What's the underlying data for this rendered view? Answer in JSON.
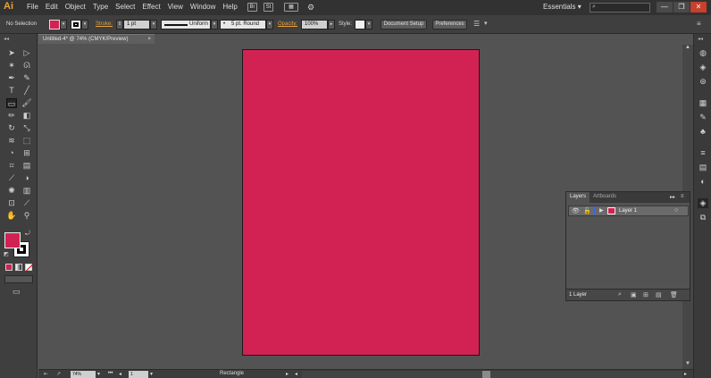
{
  "app": {
    "logo": "Ai"
  },
  "menu": [
    "File",
    "Edit",
    "Object",
    "Type",
    "Select",
    "Effect",
    "View",
    "Window",
    "Help"
  ],
  "header": {
    "bridge_label": "Br",
    "stock_label": "St",
    "workspace": "Essentials",
    "workspace_caret": "▾",
    "search_placeholder": ""
  },
  "window_buttons": {
    "minimize": "—",
    "restore": "❐",
    "close": "✕"
  },
  "controlbar": {
    "selection": "No Selection",
    "stroke_label": "Stroke:",
    "stroke_weight": "1 pt",
    "uniform": "Uniform",
    "brush": "5 pt. Round",
    "opacity_label": "Opacity:",
    "opacity": "100%",
    "style_label": "Style:",
    "document_setup": "Document Setup",
    "preferences": "Preferences"
  },
  "doc_tab": {
    "title": "Untitled-4* @ 74% (CMYK/Preview)",
    "close": "×"
  },
  "colors": {
    "fill": "#d22254",
    "accent": "#e8a23b"
  },
  "layers_panel": {
    "tabs": [
      "Layers",
      "Artboards"
    ],
    "layer_name": "Layer 1",
    "count": "1 Layer",
    "collapse": "▸▸",
    "menu": "≡"
  },
  "status": {
    "zoom": "74%",
    "artboard": "1",
    "tool": "Rectangle"
  },
  "tools": [
    "selection-icon",
    "direct-selection-icon",
    "magic-wand-icon",
    "lasso-icon",
    "pen-icon",
    "curvature-icon",
    "type-icon",
    "line-icon",
    "rectangle-icon",
    "paintbrush-icon",
    "pencil-icon",
    "eraser-icon",
    "rotate-icon",
    "scale-icon",
    "width-icon",
    "free-transform-icon",
    "shape-builder-icon",
    "perspective-icon",
    "mesh-icon",
    "gradient-icon",
    "eyedropper-icon",
    "blend-icon",
    "symbol-sprayer-icon",
    "graph-icon",
    "artboard-icon",
    "slice-icon",
    "hand-icon",
    "zoom-icon"
  ]
}
